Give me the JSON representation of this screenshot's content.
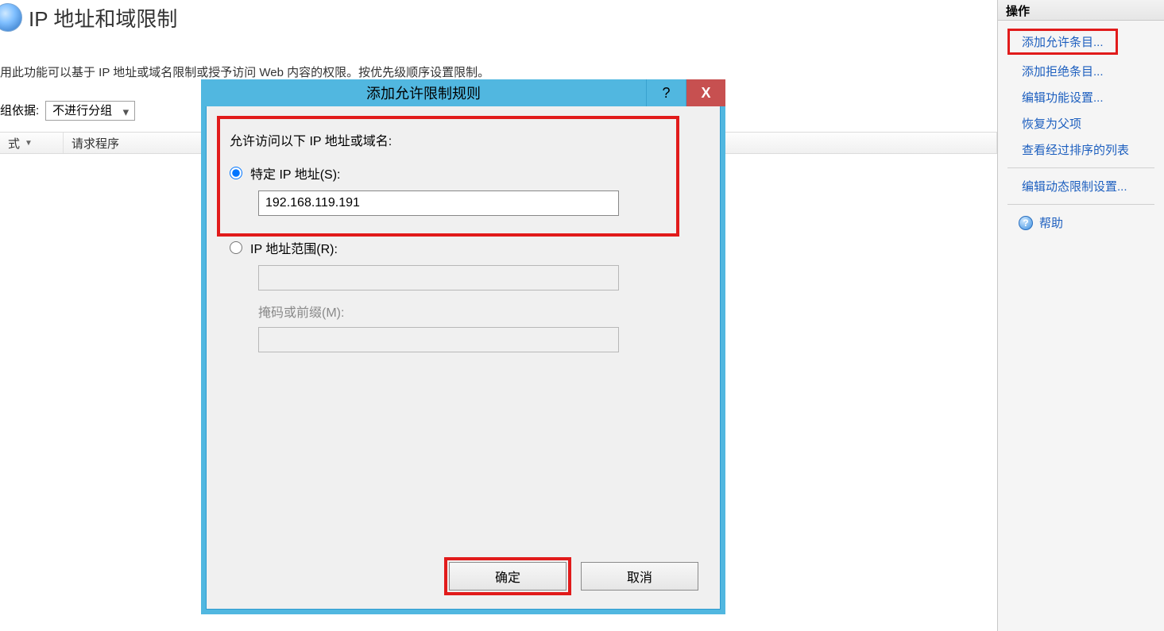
{
  "page": {
    "title": "IP 地址和域限制",
    "description": "用此功能可以基于 IP 地址或域名限制或授予访问 Web 内容的权限。按优先级顺序设置限制。"
  },
  "group": {
    "label": "组依据:",
    "selected": "不进行分组"
  },
  "table": {
    "cols": [
      "式",
      "请求程序"
    ]
  },
  "dialog": {
    "title": "添加允许限制规则",
    "prompt": "允许访问以下 IP 地址或域名:",
    "opt_specific": "特定 IP 地址(S):",
    "ip_value": "192.168.119.191",
    "opt_range": "IP 地址范围(R):",
    "mask_label": "掩码或前缀(M):",
    "ok": "确定",
    "cancel": "取消",
    "help_btn": "?",
    "close_btn": "X"
  },
  "actions": {
    "title": "操作",
    "add_allow": "添加允许条目...",
    "add_deny": "添加拒绝条目...",
    "edit_feature": "编辑功能设置...",
    "revert": "恢复为父项",
    "view_ordered": "查看经过排序的列表",
    "edit_dynamic": "编辑动态限制设置...",
    "help": "帮助"
  }
}
